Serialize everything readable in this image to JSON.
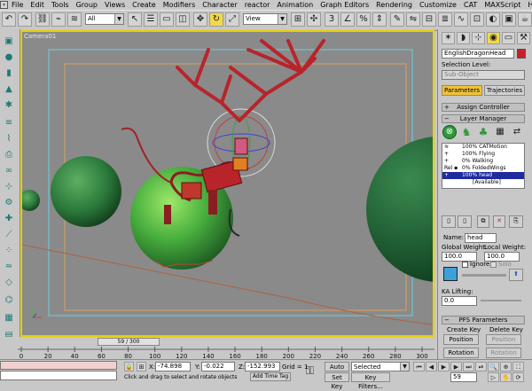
{
  "menu": {
    "items": [
      "File",
      "Edit",
      "Tools",
      "Group",
      "Views",
      "Create",
      "Modifiers",
      "Character",
      "reactor",
      "Animation",
      "Graph Editors",
      "Rendering",
      "Customize",
      "CAT",
      "MAXScript",
      "Help"
    ]
  },
  "toolbar": {
    "selection_filter": "All",
    "ref_coord": "View"
  },
  "viewport": {
    "label": "Camera01"
  },
  "panel": {
    "object_name": "EnglishDragonHead",
    "selection_level_label": "Selection Level:",
    "sub_object": "Sub-Object",
    "tab_parameters": "Parameters",
    "tab_trajectories": "Trajectories",
    "rollout_assign": "Assign Controller",
    "rollout_layer": "Layer Manager",
    "layers": [
      {
        "weight": "100%",
        "name": "CATMotion"
      },
      {
        "weight": "100%",
        "name": "Flying"
      },
      {
        "weight": "0%",
        "name": "Walking"
      },
      {
        "weight": "0%",
        "name": "FoldedWings"
      },
      {
        "weight": "100%",
        "name": "head"
      },
      {
        "weight": "",
        "name": "[Available]"
      }
    ],
    "name_label": "Name:",
    "name_value": "head",
    "global_weight_label": "Global Weight:",
    "local_weight_label": "Local Weight:",
    "global_weight_value": "100.0",
    "local_weight_value": "100.0",
    "ignore_label": "Ignore",
    "solo_label": "Solo",
    "ka_lifting_label": "KA Lifting:",
    "ka_lifting_value": "0.0",
    "rollout_pfs": "PFS Parameters",
    "create_key": "Create Key",
    "delete_key": "Delete Key",
    "position": "Position",
    "position2": "Position",
    "rotation": "Rotation",
    "rotation2": "Rotation"
  },
  "timeline": {
    "frame_text": "59 / 300",
    "ticks": [
      "0",
      "20",
      "40",
      "60",
      "80",
      "100",
      "120",
      "140",
      "160",
      "180",
      "200",
      "220",
      "240",
      "260",
      "280",
      "300"
    ]
  },
  "status": {
    "x_label": "X:",
    "x_value": "-74.898",
    "y_label": "Y:",
    "y_value": "-0.022",
    "z_label": "Z:",
    "z_value": "-152.993",
    "grid": "Grid = 1",
    "auto_key": "Auto Key",
    "selected": "Selected",
    "set_key": "Set Key",
    "key_filters": "Key Filters...",
    "add_time_tag": "Add Time Tag",
    "prompt": "Click and drag to select and rotate objects",
    "frame_value": "59"
  },
  "colors": {
    "viewport_bg": "#8a8a8a",
    "viewport_border": "#e8d000",
    "active_tab": "#f2c233",
    "selected_layer": "#1e2aa0",
    "sphere_green": "#2e8a3e",
    "dragon_red": "#b8242a"
  }
}
